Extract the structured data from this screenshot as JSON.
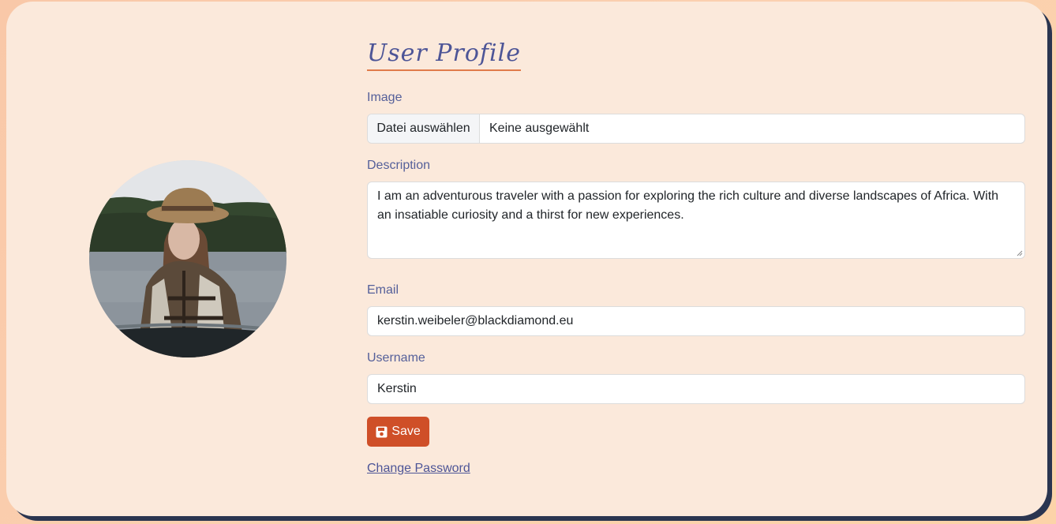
{
  "profile": {
    "title": "User Profile",
    "image": {
      "label": "Image",
      "button_label": "Datei auswählen",
      "status": "Keine ausgewählt"
    },
    "description": {
      "label": "Description",
      "value": "I am an adventurous traveler with a passion for exploring the rich culture and diverse landscapes of Africa. With an insatiable curiosity and a thirst for new experiences."
    },
    "email": {
      "label": "Email",
      "value": "kerstin.weibeler@blackdiamond.eu"
    },
    "username": {
      "label": "Username",
      "value": "Kerstin"
    },
    "save_label": "Save",
    "change_password_label": "Change Password"
  },
  "colors": {
    "accent": "#cf4f28",
    "label": "#55609a",
    "card_bg": "#fbe9db"
  },
  "icons": {
    "save": "floppy-disk-icon"
  }
}
